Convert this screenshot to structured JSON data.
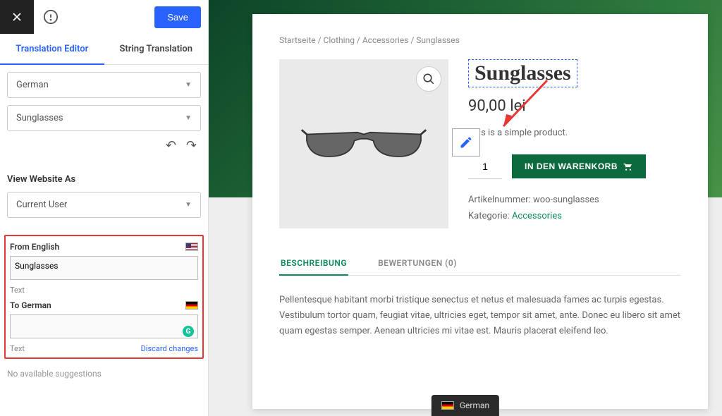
{
  "sidebar": {
    "save_label": "Save",
    "tabs": {
      "editor": "Translation Editor",
      "strings": "String Translation"
    },
    "lang_select": "German",
    "item_select": "Sunglasses",
    "view_as_label": "View Website As",
    "view_as_value": "Current User",
    "from_label": "From English",
    "from_value": "Sunglasses",
    "to_label": "To German",
    "to_value": "",
    "text_hint": "Text",
    "discard_label": "Discard changes",
    "no_suggestions": "No available suggestions"
  },
  "preview": {
    "breadcrumb": {
      "home": "Startseite",
      "cat1": "Clothing",
      "cat2": "Accessories",
      "product": "Sunglasses"
    },
    "title": "Sunglasses",
    "price": "90,00 lei",
    "short_desc": "This is a simple product.",
    "qty": "1",
    "add_to_cart": "IN DEN WARENKORB",
    "sku_label": "Artikelnummer:",
    "sku_value": "woo-sunglasses",
    "cat_label": "Kategorie:",
    "cat_link": "Accessories",
    "tabs": {
      "desc": "BESCHREIBUNG",
      "reviews": "BEWERTUNGEN (0)"
    },
    "desc_body": "Pellentesque habitant morbi tristique senectus et netus et malesuada fames ac turpis egestas. Vestibulum tortor quam, feugiat vitae, ultricies eget, tempor sit amet, ante. Donec eu libero sit amet quam egestas semper. Aenean ultricies mi vitae est. Mauris placerat eleifend leo.",
    "lang_switch": "German"
  }
}
